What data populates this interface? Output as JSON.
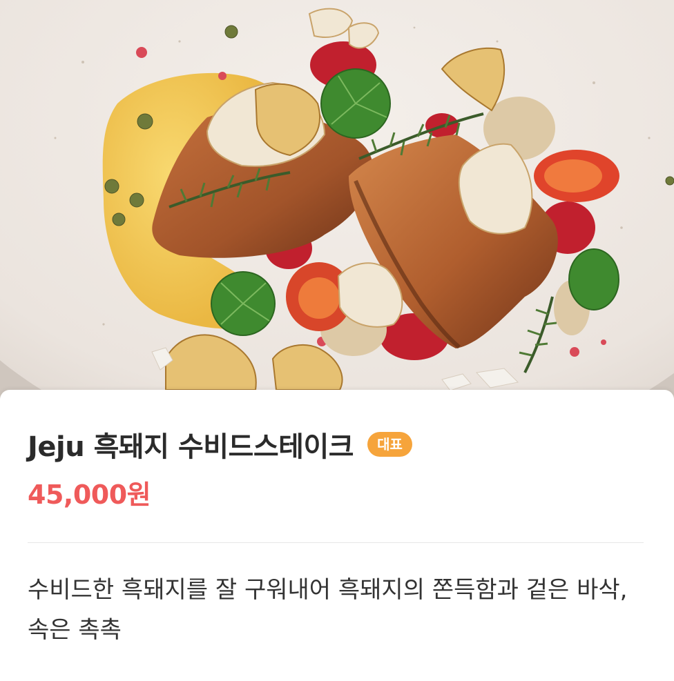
{
  "menu_item": {
    "image_alt": "흑돼지 수비드스테이크 요리 사진",
    "title": "Jeju 흑돼지 수비드스테이크",
    "badge": "대표",
    "price": "45,000원",
    "description": "수비드한 흑돼지를 잘 구워내어 흑돼지의 쫀득함과 겉은 바삭, 속은 촉촉"
  },
  "colors": {
    "badge_bg": "#f6a43b",
    "price": "#ef5a5a",
    "title": "#2b2b2b",
    "plate": "#efe9e4"
  }
}
